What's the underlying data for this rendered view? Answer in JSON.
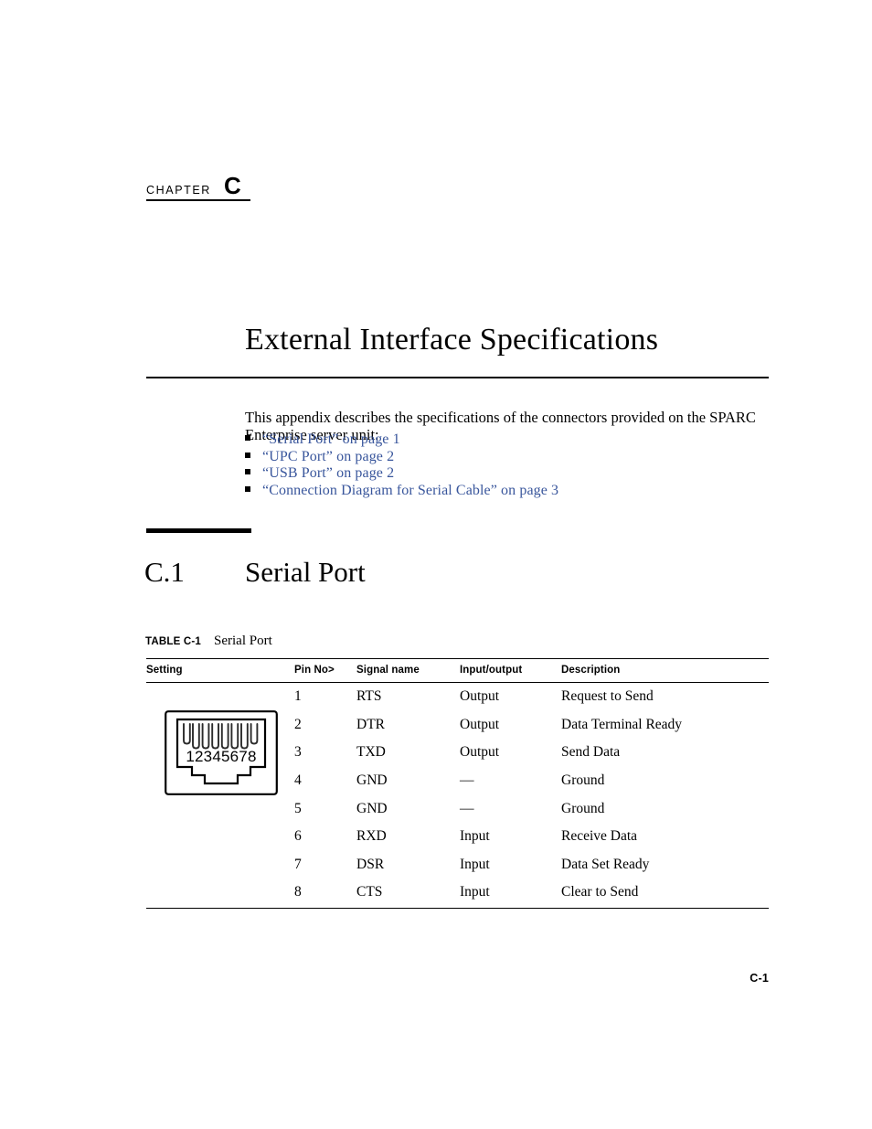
{
  "chapter": {
    "label": "CHAPTER",
    "letter": "C"
  },
  "title": "External Interface Specifications",
  "intro": "This appendix describes the specifications of the connectors provided on the SPARC Enterprise server unit:",
  "links": [
    {
      "text": "“Serial Port” on page 1"
    },
    {
      "text": "“UPC Port” on page 2"
    },
    {
      "text": "“USB Port” on page 2"
    },
    {
      "text": "“Connection Diagram for Serial Cable” on page 3"
    }
  ],
  "section": {
    "number": "C.1",
    "title": "Serial Port"
  },
  "table_caption": {
    "label": "TABLE C-1",
    "title": "Serial Port"
  },
  "table": {
    "headers": {
      "setting": "Setting",
      "pin_no": "Pin No>",
      "signal_name": "Signal name",
      "input_output": "Input/output",
      "description": "Description"
    },
    "rows": [
      {
        "pin": "1",
        "signal": "RTS",
        "io": "Output",
        "description": "Request to Send"
      },
      {
        "pin": "2",
        "signal": "DTR",
        "io": "Output",
        "description": "Data Terminal Ready"
      },
      {
        "pin": "3",
        "signal": "TXD",
        "io": "Output",
        "description": "Send Data"
      },
      {
        "pin": "4",
        "signal": "GND",
        "io": "—",
        "description": "Ground"
      },
      {
        "pin": "5",
        "signal": "GND",
        "io": "—",
        "description": "Ground"
      },
      {
        "pin": "6",
        "signal": "RXD",
        "io": "Input",
        "description": "Receive Data"
      },
      {
        "pin": "7",
        "signal": "DSR",
        "io": "Input",
        "description": "Data Set Ready"
      },
      {
        "pin": "8",
        "signal": "CTS",
        "io": "Input",
        "description": "Clear to Send"
      }
    ]
  },
  "connector_figure": {
    "pin_numbers_label": "12345678",
    "pin_count": 8
  },
  "footer": {
    "page_number": "C-1"
  },
  "colors": {
    "link": "#39569c",
    "text": "#000000",
    "rule": "#000000",
    "background": "#ffffff"
  }
}
